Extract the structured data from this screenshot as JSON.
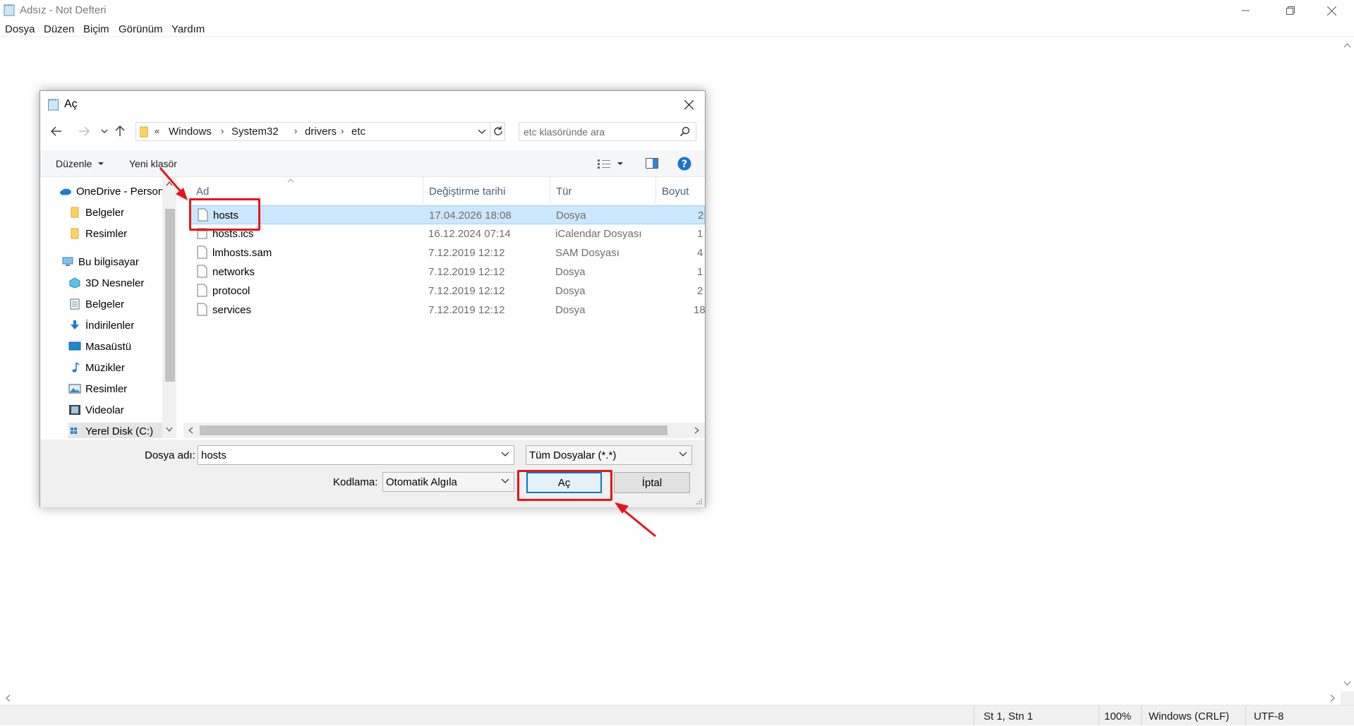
{
  "notepad": {
    "title": "Adsız - Not Defteri",
    "menu": [
      "Dosya",
      "Düzen",
      "Biçim",
      "Görünüm",
      "Yardım"
    ],
    "status": {
      "position": "St 1, Stn 1",
      "zoom": "100%",
      "line_ending": "Windows (CRLF)",
      "encoding": "UTF-8"
    }
  },
  "dialog": {
    "title": "Aç",
    "address": [
      "«",
      "Windows",
      "System32",
      "drivers",
      "etc"
    ],
    "search_placeholder": "etc klasöründe ara",
    "toolbar": {
      "organize": "Düzenle",
      "new_folder": "Yeni klasör"
    },
    "nav": [
      {
        "label": "OneDrive - Person",
        "icon": "onedrive-icon"
      },
      {
        "label": "Belgeler",
        "icon": "folder-icon"
      },
      {
        "label": "Resimler",
        "icon": "folder-icon"
      },
      {
        "label": "Bu bilgisayar",
        "icon": "computer-icon"
      },
      {
        "label": "3D Nesneler",
        "icon": "3d-objects-icon"
      },
      {
        "label": "Belgeler",
        "icon": "documents-icon"
      },
      {
        "label": "İndirilenler",
        "icon": "downloads-icon"
      },
      {
        "label": "Masaüstü",
        "icon": "desktop-icon"
      },
      {
        "label": "Müzikler",
        "icon": "music-icon"
      },
      {
        "label": "Resimler",
        "icon": "pictures-icon"
      },
      {
        "label": "Videolar",
        "icon": "videos-icon"
      },
      {
        "label": "Yerel Disk (C:)",
        "icon": "drive-icon"
      }
    ],
    "columns": [
      "Ad",
      "Değiştirme tarihi",
      "Tür",
      "Boyut"
    ],
    "files": [
      {
        "name": "hosts",
        "date": "17.04.2026 18:08",
        "type": "Dosya",
        "size": "2"
      },
      {
        "name": "hosts.ics",
        "date": "16.12.2024 07:14",
        "type": "iCalendar Dosyası",
        "size": "1"
      },
      {
        "name": "lmhosts.sam",
        "date": "7.12.2019 12:12",
        "type": "SAM Dosyası",
        "size": "4"
      },
      {
        "name": "networks",
        "date": "7.12.2019 12:12",
        "type": "Dosya",
        "size": "1"
      },
      {
        "name": "protocol",
        "date": "7.12.2019 12:12",
        "type": "Dosya",
        "size": "2"
      },
      {
        "name": "services",
        "date": "7.12.2019 12:12",
        "type": "Dosya",
        "size": "18"
      }
    ],
    "filename_label": "Dosya adı:",
    "filename_value": "hosts",
    "filter_value": "Tüm Dosyalar  (*.*)",
    "encoding_label": "Kodlama:",
    "encoding_value": "Otomatik Algıla",
    "open_button": "Aç",
    "cancel_button": "İptal"
  },
  "colors": {
    "highlight": "#e8141a",
    "selection": "#cce8ff",
    "accent": "#0078d7"
  }
}
